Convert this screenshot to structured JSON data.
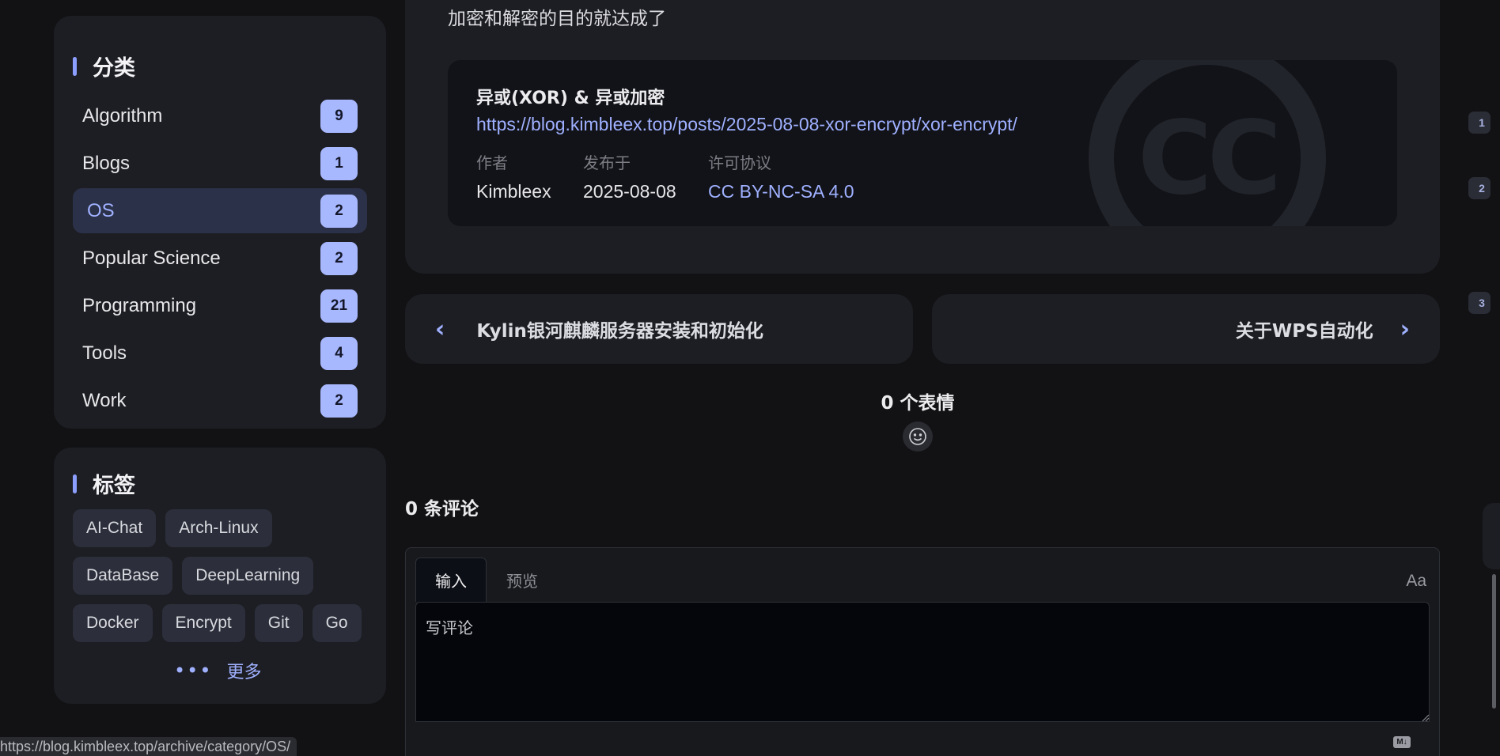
{
  "sidebar": {
    "categories": {
      "title": "分类",
      "items": [
        {
          "name": "Algorithm",
          "count": "9"
        },
        {
          "name": "Blogs",
          "count": "1"
        },
        {
          "name": "OS",
          "count": "2"
        },
        {
          "name": "Popular Science",
          "count": "2"
        },
        {
          "name": "Programming",
          "count": "21"
        },
        {
          "name": "Tools",
          "count": "4"
        },
        {
          "name": "Work",
          "count": "2"
        }
      ],
      "active": "OS"
    },
    "tags": {
      "title": "标签",
      "items": [
        "AI-Chat",
        "Arch-Linux",
        "DataBase",
        "DeepLearning",
        "Docker",
        "Encrypt",
        "Git",
        "Go"
      ],
      "more_label": "更多"
    }
  },
  "status_bar": {
    "url": "https://blog.kimbleex.top/archive/category/OS/"
  },
  "article": {
    "closing_text": "加密和解密的目的就达成了",
    "license": {
      "title": "异或(XOR) & 异或加密",
      "url": "https://blog.kimbleex.top/posts/2025-08-08-xor-encrypt/xor-encrypt/",
      "watermark": "CC",
      "author_label": "作者",
      "author": "Kimbleex",
      "published_label": "发布于",
      "published": "2025-08-08",
      "license_label": "许可协议",
      "license": "CC BY-NC-SA 4.0"
    }
  },
  "post_nav": {
    "prev": "Kylin银河麒麟服务器安装和初始化",
    "next": "关于WPS自动化"
  },
  "reactions": {
    "title": "0 个表情"
  },
  "comments": {
    "title": "0 条评论",
    "tabs": [
      "输入",
      "预览"
    ],
    "font_toggle": "Aa",
    "placeholder": "写评论",
    "markdown_badge": "M↓"
  },
  "toc": [
    "1",
    "2",
    "3"
  ],
  "colors": {
    "accent": "#9fb0ff",
    "badge": "#a8b8ff",
    "card": "#1d1e23",
    "background": "#121214"
  }
}
